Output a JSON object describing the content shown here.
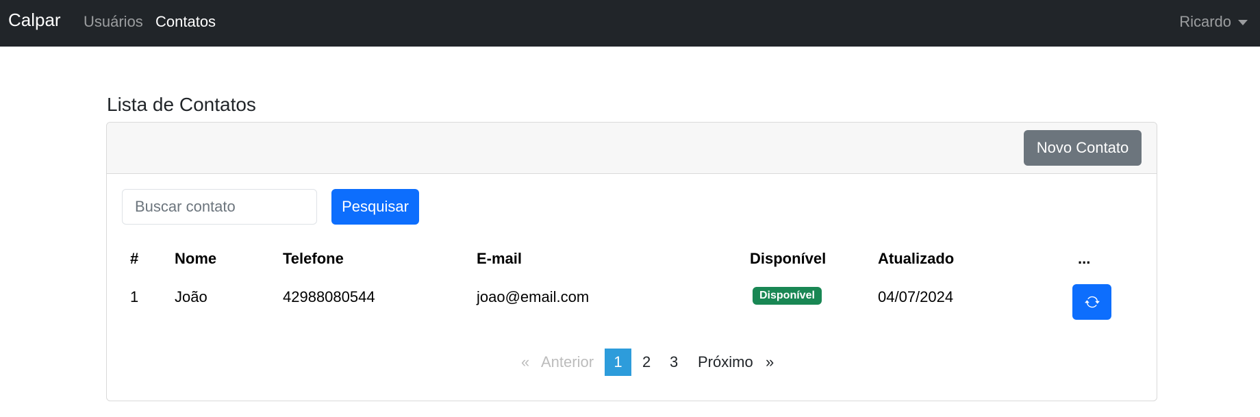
{
  "navbar": {
    "brand": "Calpar",
    "links": [
      {
        "label": "Usuários"
      },
      {
        "label": "Contatos"
      }
    ],
    "user": "Ricardo"
  },
  "page": {
    "title": "Lista de Contatos"
  },
  "toolbar": {
    "new_contact_label": "Novo Contato",
    "search_placeholder": "Buscar contato",
    "search_value": "",
    "search_button_label": "Pesquisar"
  },
  "table": {
    "headers": [
      "#",
      "Nome",
      "Telefone",
      "E-mail",
      "Disponível",
      "Atualizado",
      "..."
    ],
    "rows": [
      {
        "id": "1",
        "name": "João",
        "phone": "42988080544",
        "email": "joao@email.com",
        "status": "Disponível",
        "updated": "04/07/2024"
      }
    ]
  },
  "pagination": {
    "first_symbol": "«",
    "prev_label": "Anterior",
    "pages": [
      "1",
      "2",
      "3"
    ],
    "active_page": "1",
    "next_label": "Próximo",
    "last_symbol": "»"
  },
  "colors": {
    "navbar_bg": "#212529",
    "primary": "#0d6efd",
    "secondary": "#6c757d",
    "success": "#198754",
    "active_page": "#2d9cdb"
  },
  "icons": {
    "refresh_button": "refresh-icon",
    "user_menu": "chevron-down-icon"
  }
}
